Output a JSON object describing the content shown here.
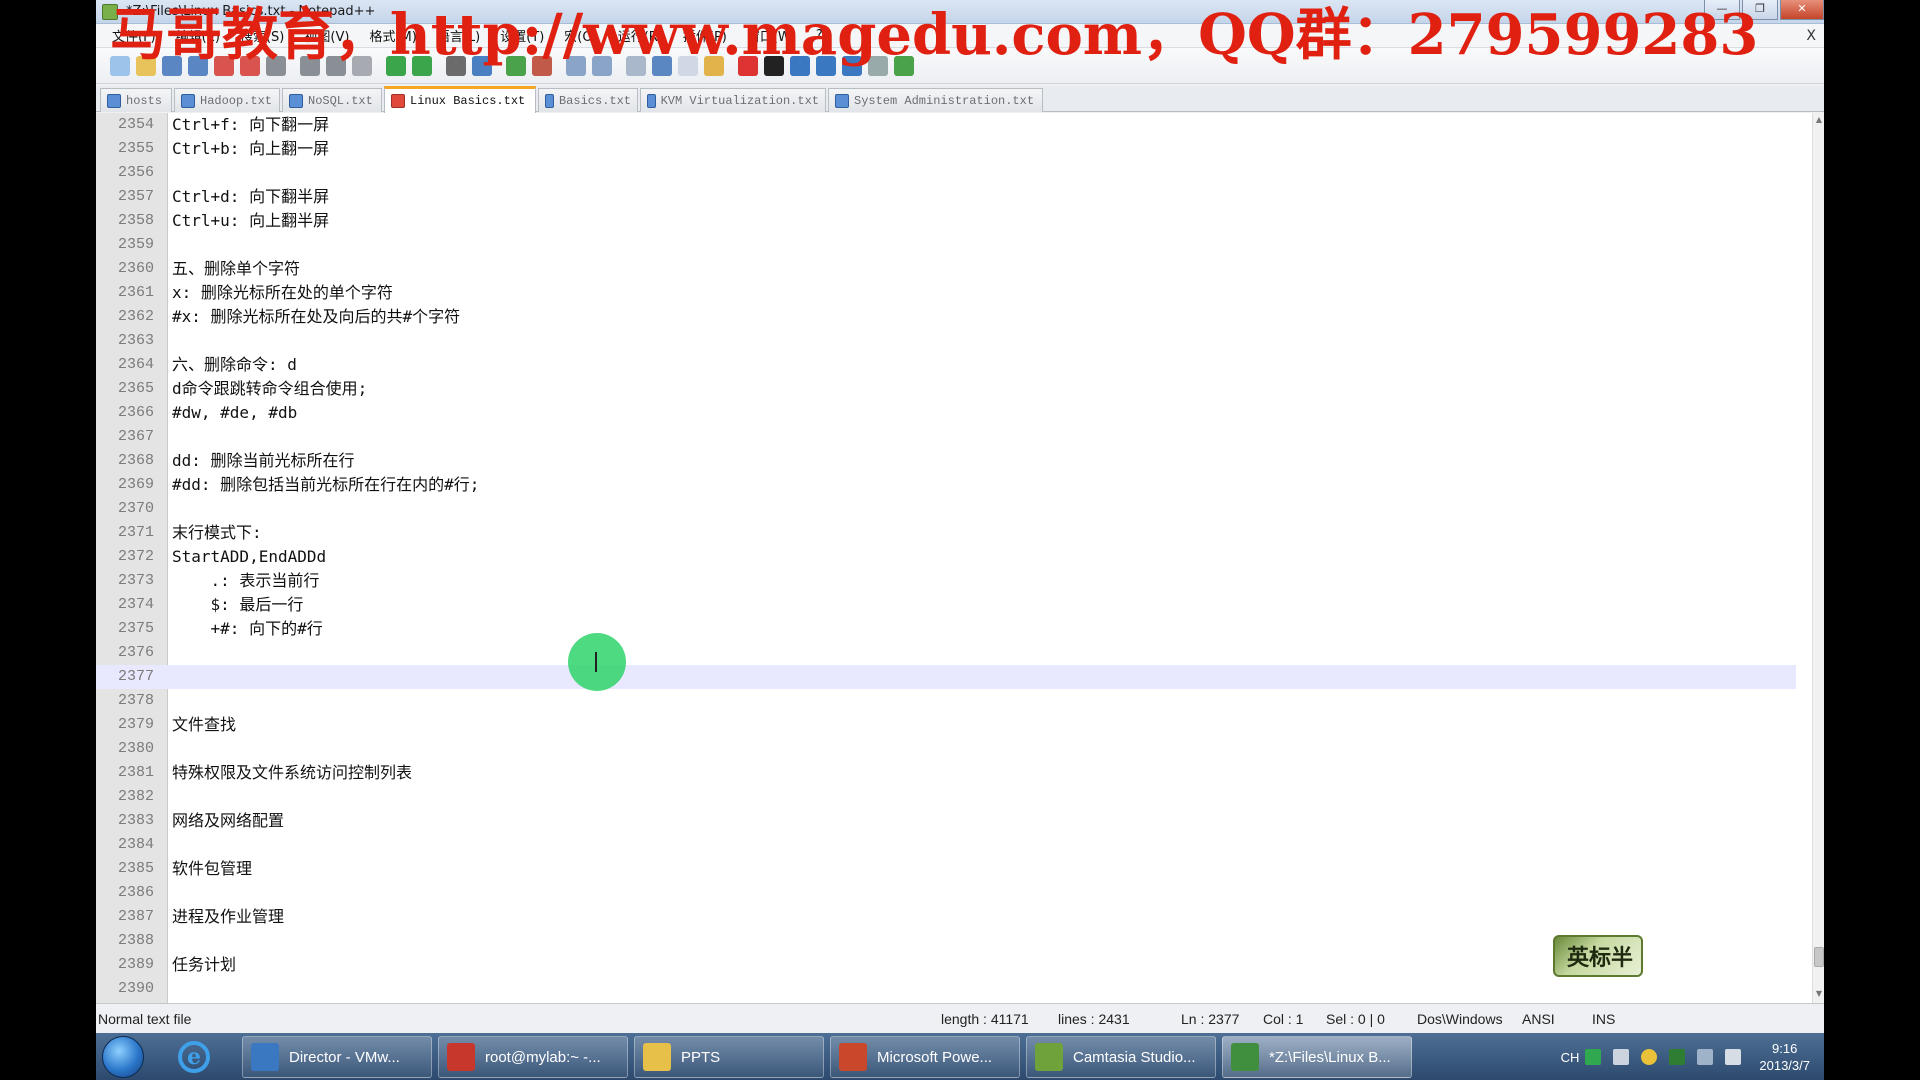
{
  "window": {
    "title": "*Z:\\Files\\Linux Basics.txt - Notepad++",
    "minimize": "—",
    "maximize": "❐",
    "close": "✕"
  },
  "watermark": "马哥教育，http://www.magedu.com，QQ群：279599283",
  "menu": {
    "items": [
      "文件(F)",
      "编辑(E)",
      "搜索(S)",
      "视图(V)",
      "格式(M)",
      "语言(L)",
      "设置(T)",
      "宏(O)",
      "运行(R)",
      "插件(P)",
      "窗口(W)",
      "?"
    ],
    "close": "X"
  },
  "tabs": [
    {
      "label": "hosts"
    },
    {
      "label": "Hadoop.txt"
    },
    {
      "label": "NoSQL.txt"
    },
    {
      "label": "Linux Basics.txt",
      "active": true
    },
    {
      "label": "Basics.txt"
    },
    {
      "label": "KVM Virtualization.txt"
    },
    {
      "label": "System Administration.txt"
    }
  ],
  "editor": {
    "current_line": 2377,
    "lines": [
      {
        "n": "2354",
        "t": "Ctrl+f: 向下翻一屏"
      },
      {
        "n": "2355",
        "t": "Ctrl+b: 向上翻一屏"
      },
      {
        "n": "2356",
        "t": ""
      },
      {
        "n": "2357",
        "t": "Ctrl+d: 向下翻半屏"
      },
      {
        "n": "2358",
        "t": "Ctrl+u: 向上翻半屏"
      },
      {
        "n": "2359",
        "t": ""
      },
      {
        "n": "2360",
        "t": "五、删除单个字符"
      },
      {
        "n": "2361",
        "t": "x: 删除光标所在处的单个字符"
      },
      {
        "n": "2362",
        "t": "#x: 删除光标所在处及向后的共#个字符"
      },
      {
        "n": "2363",
        "t": ""
      },
      {
        "n": "2364",
        "t": "六、删除命令: d"
      },
      {
        "n": "2365",
        "t": "d命令跟跳转命令组合使用;"
      },
      {
        "n": "2366",
        "t": "#dw, #de, #db"
      },
      {
        "n": "2367",
        "t": ""
      },
      {
        "n": "2368",
        "t": "dd: 删除当前光标所在行"
      },
      {
        "n": "2369",
        "t": "#dd: 删除包括当前光标所在行在内的#行;"
      },
      {
        "n": "2370",
        "t": ""
      },
      {
        "n": "2371",
        "t": "末行模式下:"
      },
      {
        "n": "2372",
        "t": "StartADD,EndADDd"
      },
      {
        "n": "2373",
        "t": "    .: 表示当前行"
      },
      {
        "n": "2374",
        "t": "    $: 最后一行"
      },
      {
        "n": "2375",
        "t": "    +#: 向下的#行"
      },
      {
        "n": "2376",
        "t": ""
      },
      {
        "n": "2377",
        "t": ""
      },
      {
        "n": "2378",
        "t": ""
      },
      {
        "n": "2379",
        "t": "文件查找"
      },
      {
        "n": "2380",
        "t": ""
      },
      {
        "n": "2381",
        "t": "特殊权限及文件系统访问控制列表"
      },
      {
        "n": "2382",
        "t": ""
      },
      {
        "n": "2383",
        "t": "网络及网络配置"
      },
      {
        "n": "2384",
        "t": ""
      },
      {
        "n": "2385",
        "t": "软件包管理"
      },
      {
        "n": "2386",
        "t": ""
      },
      {
        "n": "2387",
        "t": "进程及作业管理"
      },
      {
        "n": "2388",
        "t": ""
      },
      {
        "n": "2389",
        "t": "任务计划"
      },
      {
        "n": "2390",
        "t": ""
      }
    ]
  },
  "badge": "英标半",
  "status": {
    "file_type": "Normal text file",
    "length": "length : 41171",
    "lines": "lines : 2431",
    "ln": "Ln : 2377",
    "col": "Col : 1",
    "sel": "Sel : 0 | 0",
    "eol": "Dos\\Windows",
    "encoding": "ANSI",
    "mode": "INS"
  },
  "taskbar": {
    "tasks": [
      {
        "label": "Director - VMw..."
      },
      {
        "label": "root@mylab:~ -..."
      },
      {
        "label": "PPTS"
      },
      {
        "label": "Microsoft Powe..."
      },
      {
        "label": "Camtasia Studio..."
      },
      {
        "label": "*Z:\\Files\\Linux B...",
        "active": true
      }
    ],
    "tray_lang": "CH",
    "clock_time": "9:16",
    "clock_date": "2013/3/7"
  },
  "colors": {
    "watermark": "#e02010",
    "current_line_bg": "#e8e8ff",
    "active_tab_accent": "#f5a623",
    "cursor_highlight": "#2fd46a"
  }
}
